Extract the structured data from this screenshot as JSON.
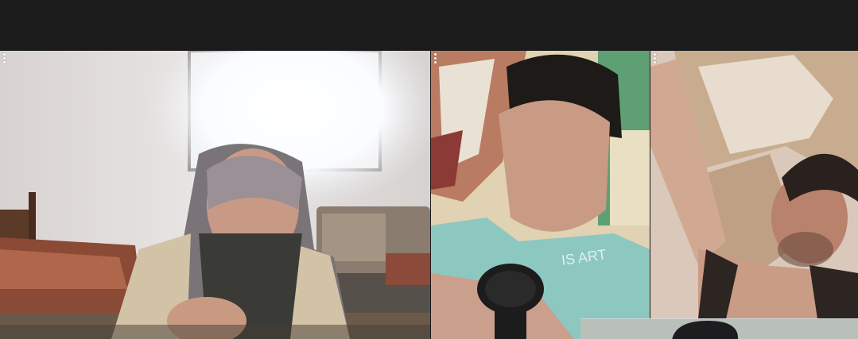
{
  "top_bar": {},
  "participants": [
    {
      "id": "participant-1",
      "options_icon": "more-vertical-icon"
    },
    {
      "id": "participant-2",
      "options_icon": "more-vertical-icon"
    },
    {
      "id": "participant-3",
      "options_icon": "more-vertical-icon"
    }
  ],
  "self_view": {},
  "colors": {
    "background": "#1b1b1b",
    "dots": "#ffffff"
  }
}
